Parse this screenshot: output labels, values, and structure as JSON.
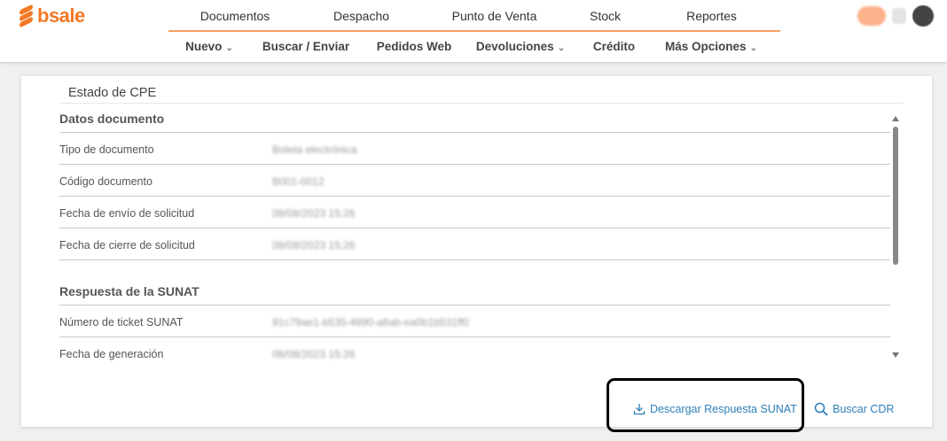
{
  "brand": {
    "name": "bsale"
  },
  "main_nav": [
    "Documentos",
    "Despacho",
    "Punto de Venta",
    "Stock",
    "Reportes"
  ],
  "sub_nav": [
    {
      "label": "Nuevo",
      "dropdown": true
    },
    {
      "label": "Buscar / Enviar",
      "dropdown": false
    },
    {
      "label": "Pedidos Web",
      "dropdown": false
    },
    {
      "label": "Devoluciones",
      "dropdown": true
    },
    {
      "label": "Crédito",
      "dropdown": false
    },
    {
      "label": "Más Opciones",
      "dropdown": true
    }
  ],
  "header_right": {
    "badge": "•••",
    "avatar": "•"
  },
  "panel": {
    "title": "Estado de CPE",
    "sections": [
      {
        "title": "Datos documento",
        "rows": [
          {
            "label": "Tipo de documento",
            "value": "Boleta electrónica"
          },
          {
            "label": "Código documento",
            "value": "B001-0012"
          },
          {
            "label": "Fecha de envío de solicitud",
            "value": "08/08/2023 15:26"
          },
          {
            "label": "Fecha de cierre de solicitud",
            "value": "08/08/2023 15:26"
          }
        ]
      },
      {
        "title": "Respuesta de la SUNAT",
        "rows": [
          {
            "label": "Número de ticket SUNAT",
            "value": "91c79ae1-b535-4890-a6ab-ea0b1b531ff0"
          },
          {
            "label": "Fecha de generación",
            "value": "08/08/2023 15:26"
          }
        ]
      }
    ]
  },
  "actions": {
    "download_label": "Descargar Respuesta SUNAT",
    "search_label": "Buscar CDR"
  },
  "colors": {
    "brand": "#f47825",
    "link": "#2d7fb8",
    "highlight": "#000000"
  }
}
